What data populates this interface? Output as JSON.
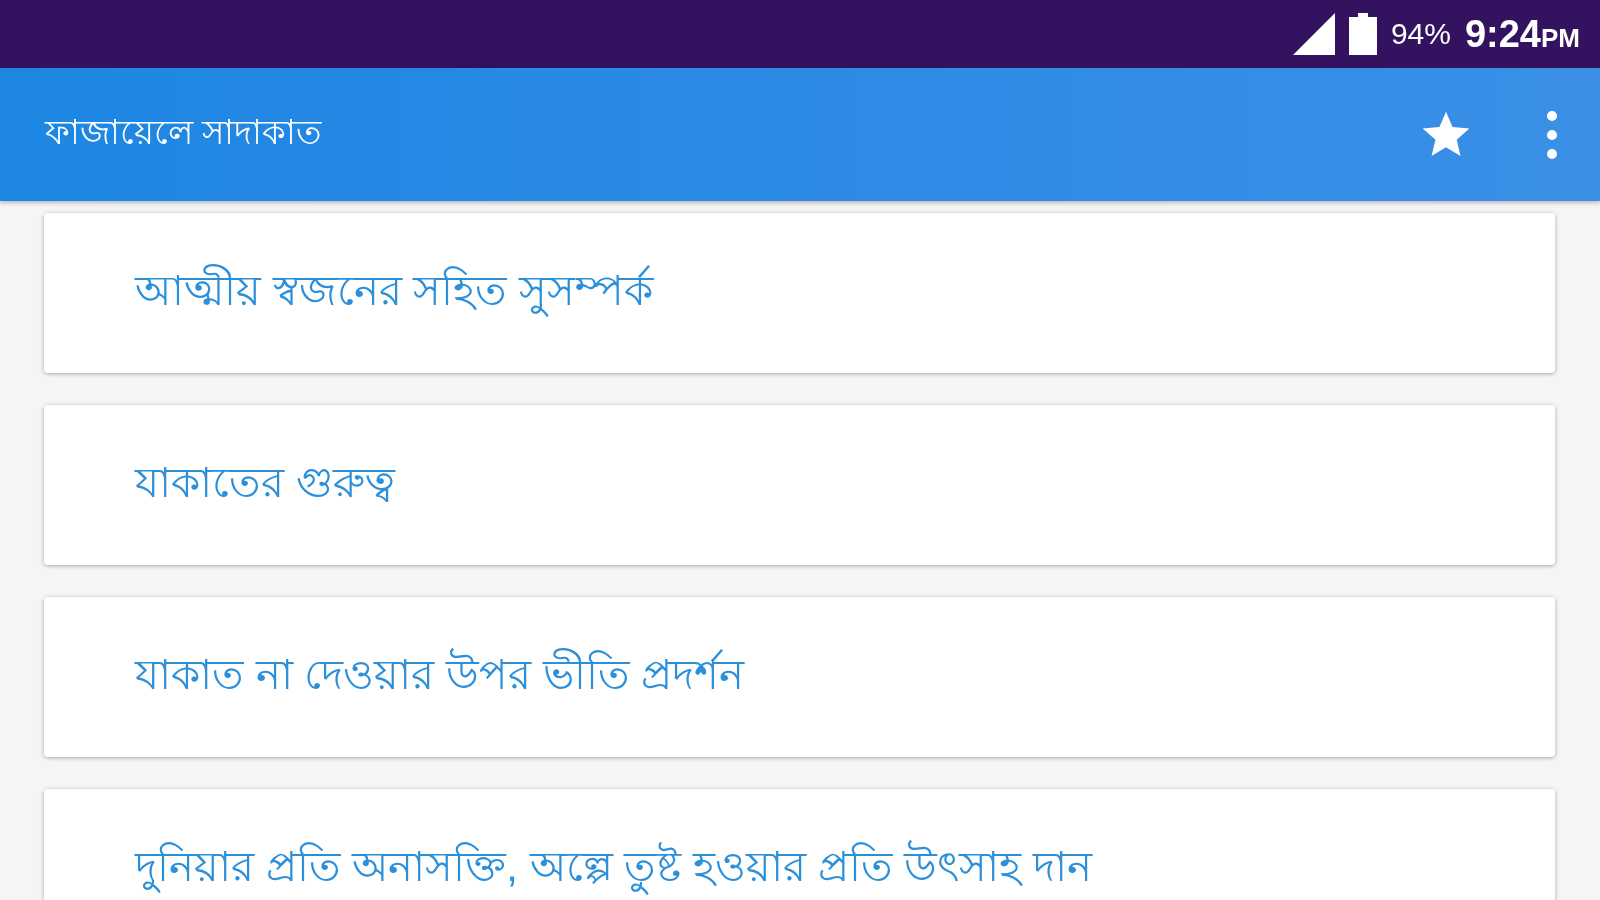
{
  "status_bar": {
    "battery": "94%",
    "time": "9:24",
    "period": "PM"
  },
  "app_bar": {
    "title": "ফাজায়েলে সাদাকাত"
  },
  "items": [
    {
      "title": "আত্মীয় স্বজনের সহিত সুসম্পর্ক"
    },
    {
      "title": "যাকাতের গুরুত্ব"
    },
    {
      "title": "যাকাত না দেওয়ার উপর ভীতি প্রদর্শন"
    },
    {
      "title": "দুনিয়ার প্রতি অনাসক্তি, অল্পে তুষ্ট হওয়ার প্রতি উৎসাহ দান"
    }
  ]
}
